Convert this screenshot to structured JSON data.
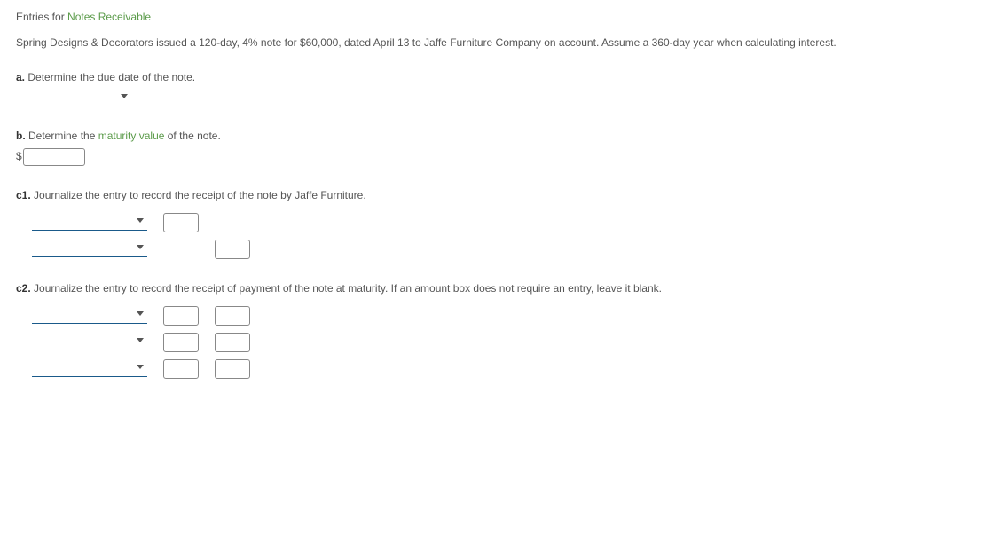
{
  "title": {
    "prefix": "Entries for ",
    "link": "Notes Receivable"
  },
  "problem": "Spring Designs & Decorators issued a 120-day, 4% note for $60,000, dated April 13 to Jaffe Furniture Company on account. Assume a 360-day year when calculating interest.",
  "parts": {
    "a": {
      "label": "a.",
      "text": "  Determine the due date of the note."
    },
    "b": {
      "label": "b.",
      "text_pre": "  Determine the ",
      "link": "maturity value",
      "text_post": " of the note.",
      "dollar": "$"
    },
    "c1": {
      "label": "c1.",
      "text": "  Journalize the entry to record the receipt of the note by Jaffe Furniture."
    },
    "c2": {
      "label": "c2.",
      "text": "  Journalize the entry to record the receipt of payment of the note at maturity. If an amount box does not require an entry, leave it blank."
    }
  }
}
